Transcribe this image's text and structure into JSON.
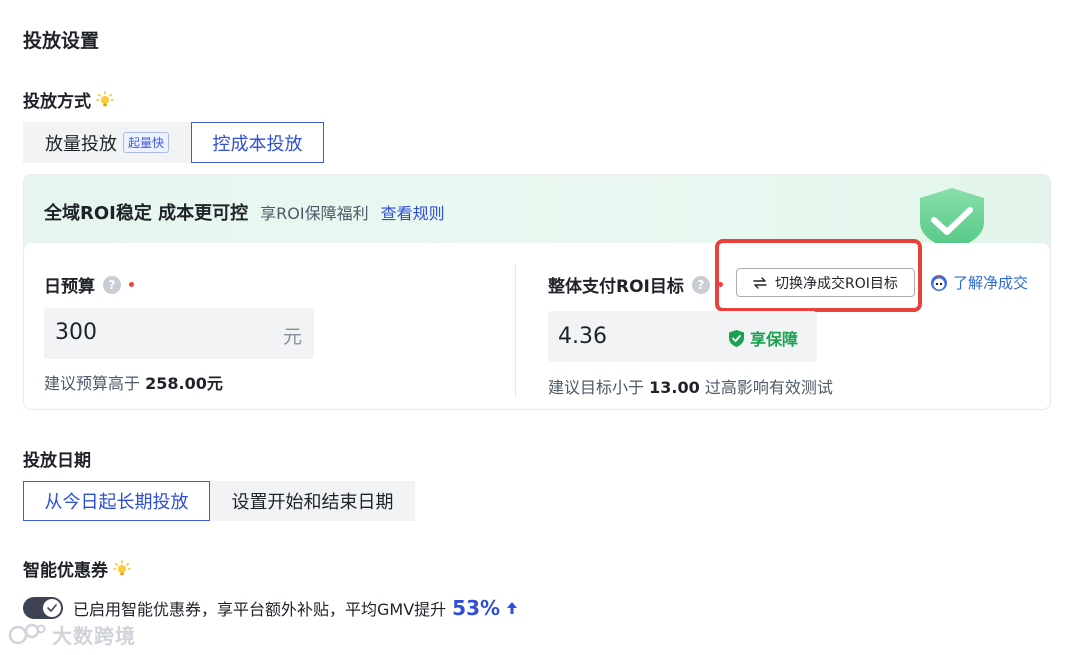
{
  "page": {
    "title": "投放设置"
  },
  "method": {
    "label": "投放方式",
    "tabs": [
      {
        "label": "放量投放",
        "tag": "起量快",
        "active": false
      },
      {
        "label": "控成本投放",
        "active": true
      }
    ]
  },
  "promo": {
    "title": "全域ROI稳定 成本更可控",
    "subtitle": "享ROI保障福利",
    "link": "查看规则"
  },
  "budget": {
    "label": "日预算",
    "value": "300",
    "unit": "元",
    "hint_prefix": "建议预算高于",
    "hint_value": "258.00元"
  },
  "roi": {
    "label": "整体支付ROI目标",
    "switch_label": "切换净成交ROI目标",
    "learn_link": "了解净成交",
    "value": "4.36",
    "guarantee": "享保障",
    "hint_prefix": "建议目标小于",
    "hint_value": "13.00",
    "hint_suffix": "过高影响有效测试"
  },
  "date": {
    "label": "投放日期",
    "tabs": [
      {
        "label": "从今日起长期投放",
        "active": true
      },
      {
        "label": "设置开始和结束日期",
        "active": false
      }
    ]
  },
  "coupon": {
    "label": "智能优惠券",
    "enabled": true,
    "text": "已启用智能优惠券，享平台额外补贴，平均GMV提升",
    "percent": "53%"
  },
  "watermark": {
    "text": "大数跨境"
  },
  "colors": {
    "accent": "#2f4fd6",
    "success": "#1aa152",
    "highlight": "#e8403a",
    "required": "#f53f3f"
  }
}
